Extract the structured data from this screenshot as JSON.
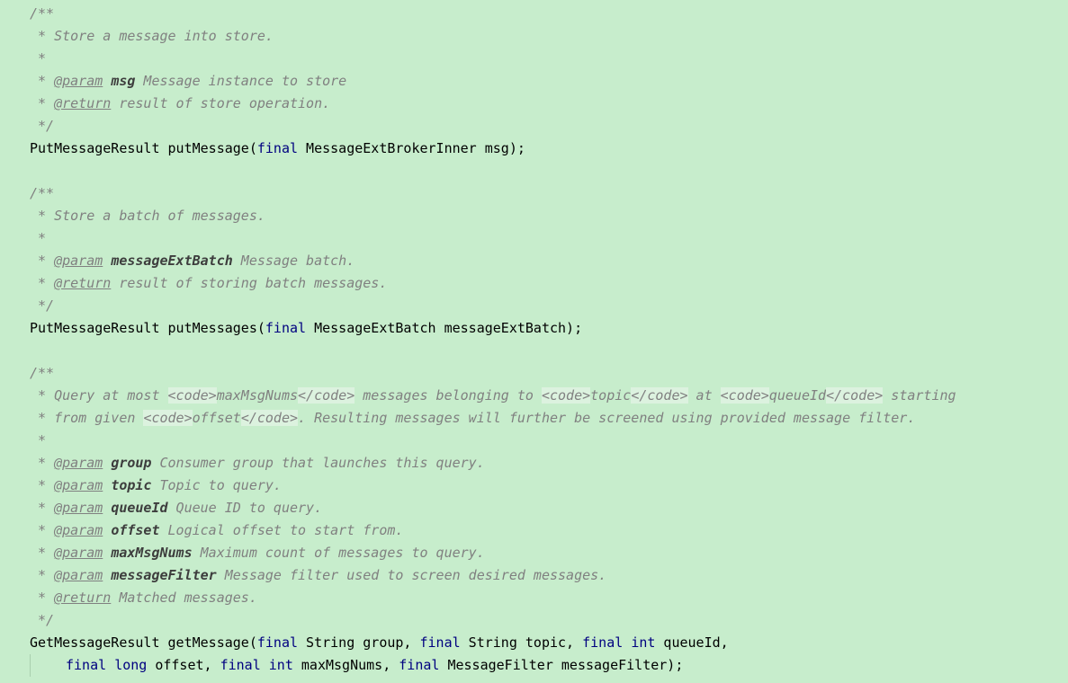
{
  "editor": {
    "background": "#c7edcc",
    "keyword_color": "#000080",
    "comment_color": "#808080",
    "code_highlight_color": "#dcf2df",
    "lines": [
      {
        "indent": 0,
        "guide": false,
        "tokens": [
          {
            "t": "c",
            "v": "/**"
          }
        ]
      },
      {
        "indent": 0,
        "guide": false,
        "tokens": [
          {
            "t": "c",
            "v": " * Store a message into store."
          }
        ]
      },
      {
        "indent": 0,
        "guide": false,
        "tokens": [
          {
            "t": "c",
            "v": " *"
          }
        ]
      },
      {
        "indent": 0,
        "guide": false,
        "tokens": [
          {
            "t": "c",
            "v": " * "
          },
          {
            "t": "tag",
            "v": "@param"
          },
          {
            "t": "c",
            "v": " "
          },
          {
            "t": "pn",
            "v": "msg"
          },
          {
            "t": "c",
            "v": " Message instance to store"
          }
        ]
      },
      {
        "indent": 0,
        "guide": false,
        "tokens": [
          {
            "t": "c",
            "v": " * "
          },
          {
            "t": "tag",
            "v": "@return"
          },
          {
            "t": "c",
            "v": " result of store operation."
          }
        ]
      },
      {
        "indent": 0,
        "guide": false,
        "tokens": [
          {
            "t": "c",
            "v": " */"
          }
        ]
      },
      {
        "indent": 0,
        "guide": false,
        "tokens": [
          {
            "t": "tx",
            "v": "PutMessageResult putMessage("
          },
          {
            "t": "kw",
            "v": "final"
          },
          {
            "t": "tx",
            "v": " MessageExtBrokerInner msg);"
          }
        ]
      },
      {
        "indent": 0,
        "guide": false,
        "tokens": []
      },
      {
        "indent": 0,
        "guide": false,
        "tokens": [
          {
            "t": "c",
            "v": "/**"
          }
        ]
      },
      {
        "indent": 0,
        "guide": false,
        "tokens": [
          {
            "t": "c",
            "v": " * Store a batch of messages."
          }
        ]
      },
      {
        "indent": 0,
        "guide": false,
        "tokens": [
          {
            "t": "c",
            "v": " *"
          }
        ]
      },
      {
        "indent": 0,
        "guide": false,
        "tokens": [
          {
            "t": "c",
            "v": " * "
          },
          {
            "t": "tag",
            "v": "@param"
          },
          {
            "t": "c",
            "v": " "
          },
          {
            "t": "pn",
            "v": "messageExtBatch"
          },
          {
            "t": "c",
            "v": " Message batch."
          }
        ]
      },
      {
        "indent": 0,
        "guide": false,
        "tokens": [
          {
            "t": "c",
            "v": " * "
          },
          {
            "t": "tag",
            "v": "@return"
          },
          {
            "t": "c",
            "v": " result of storing batch messages."
          }
        ]
      },
      {
        "indent": 0,
        "guide": false,
        "tokens": [
          {
            "t": "c",
            "v": " */"
          }
        ]
      },
      {
        "indent": 0,
        "guide": false,
        "tokens": [
          {
            "t": "tx",
            "v": "PutMessageResult putMessages("
          },
          {
            "t": "kw",
            "v": "final"
          },
          {
            "t": "tx",
            "v": " MessageExtBatch messageExtBatch);"
          }
        ]
      },
      {
        "indent": 0,
        "guide": false,
        "tokens": []
      },
      {
        "indent": 0,
        "guide": false,
        "tokens": [
          {
            "t": "c",
            "v": "/**"
          }
        ]
      },
      {
        "indent": 0,
        "guide": false,
        "tokens": [
          {
            "t": "c",
            "v": " * Query at most "
          },
          {
            "t": "hlc",
            "v": "<code>"
          },
          {
            "t": "c",
            "v": "maxMsgNums"
          },
          {
            "t": "hlc",
            "v": "</code>"
          },
          {
            "t": "c",
            "v": " messages belonging to "
          },
          {
            "t": "hlc",
            "v": "<code>"
          },
          {
            "t": "c",
            "v": "topic"
          },
          {
            "t": "hlc",
            "v": "</code>"
          },
          {
            "t": "c",
            "v": " at "
          },
          {
            "t": "hlc",
            "v": "<code>"
          },
          {
            "t": "c",
            "v": "queueId"
          },
          {
            "t": "hlc",
            "v": "</code>"
          },
          {
            "t": "c",
            "v": " starting"
          }
        ]
      },
      {
        "indent": 0,
        "guide": false,
        "tokens": [
          {
            "t": "c",
            "v": " * from given "
          },
          {
            "t": "hlc",
            "v": "<code>"
          },
          {
            "t": "c",
            "v": "offset"
          },
          {
            "t": "hlc",
            "v": "</code>"
          },
          {
            "t": "c",
            "v": ". Resulting messages will further be screened using provided message filter."
          }
        ]
      },
      {
        "indent": 0,
        "guide": false,
        "tokens": [
          {
            "t": "c",
            "v": " *"
          }
        ]
      },
      {
        "indent": 0,
        "guide": false,
        "tokens": [
          {
            "t": "c",
            "v": " * "
          },
          {
            "t": "tag",
            "v": "@param"
          },
          {
            "t": "c",
            "v": " "
          },
          {
            "t": "pn",
            "v": "group"
          },
          {
            "t": "c",
            "v": " Consumer group that launches this query."
          }
        ]
      },
      {
        "indent": 0,
        "guide": false,
        "tokens": [
          {
            "t": "c",
            "v": " * "
          },
          {
            "t": "tag",
            "v": "@param"
          },
          {
            "t": "c",
            "v": " "
          },
          {
            "t": "pn",
            "v": "topic"
          },
          {
            "t": "c",
            "v": " Topic to query."
          }
        ]
      },
      {
        "indent": 0,
        "guide": false,
        "tokens": [
          {
            "t": "c",
            "v": " * "
          },
          {
            "t": "tag",
            "v": "@param"
          },
          {
            "t": "c",
            "v": " "
          },
          {
            "t": "pn",
            "v": "queueId"
          },
          {
            "t": "c",
            "v": " Queue ID to query."
          }
        ]
      },
      {
        "indent": 0,
        "guide": false,
        "tokens": [
          {
            "t": "c",
            "v": " * "
          },
          {
            "t": "tag",
            "v": "@param"
          },
          {
            "t": "c",
            "v": " "
          },
          {
            "t": "pn",
            "v": "offset"
          },
          {
            "t": "c",
            "v": " Logical offset to start from."
          }
        ]
      },
      {
        "indent": 0,
        "guide": false,
        "tokens": [
          {
            "t": "c",
            "v": " * "
          },
          {
            "t": "tag",
            "v": "@param"
          },
          {
            "t": "c",
            "v": " "
          },
          {
            "t": "pn",
            "v": "maxMsgNums"
          },
          {
            "t": "c",
            "v": " Maximum count of messages to query."
          }
        ]
      },
      {
        "indent": 0,
        "guide": false,
        "tokens": [
          {
            "t": "c",
            "v": " * "
          },
          {
            "t": "tag",
            "v": "@param"
          },
          {
            "t": "c",
            "v": " "
          },
          {
            "t": "pn",
            "v": "messageFilter"
          },
          {
            "t": "c",
            "v": " Message filter used to screen desired messages."
          }
        ]
      },
      {
        "indent": 0,
        "guide": false,
        "tokens": [
          {
            "t": "c",
            "v": " * "
          },
          {
            "t": "tag",
            "v": "@return"
          },
          {
            "t": "c",
            "v": " Matched messages."
          }
        ]
      },
      {
        "indent": 0,
        "guide": false,
        "tokens": [
          {
            "t": "c",
            "v": " */"
          }
        ]
      },
      {
        "indent": 0,
        "guide": false,
        "tokens": [
          {
            "t": "tx",
            "v": "GetMessageResult getMessage("
          },
          {
            "t": "kw",
            "v": "final"
          },
          {
            "t": "tx",
            "v": " String group, "
          },
          {
            "t": "kw",
            "v": "final"
          },
          {
            "t": "tx",
            "v": " String topic, "
          },
          {
            "t": "kw",
            "v": "final"
          },
          {
            "t": "tx",
            "v": " "
          },
          {
            "t": "kw",
            "v": "int"
          },
          {
            "t": "tx",
            "v": " queueId,"
          }
        ]
      },
      {
        "indent": 1,
        "guide": true,
        "tokens": [
          {
            "t": "kw",
            "v": "final"
          },
          {
            "t": "tx",
            "v": " "
          },
          {
            "t": "kw",
            "v": "long"
          },
          {
            "t": "tx",
            "v": " offset, "
          },
          {
            "t": "kw",
            "v": "final"
          },
          {
            "t": "tx",
            "v": " "
          },
          {
            "t": "kw",
            "v": "int"
          },
          {
            "t": "tx",
            "v": " maxMsgNums, "
          },
          {
            "t": "kw",
            "v": "final"
          },
          {
            "t": "tx",
            "v": " MessageFilter messageFilter);"
          }
        ]
      }
    ]
  }
}
